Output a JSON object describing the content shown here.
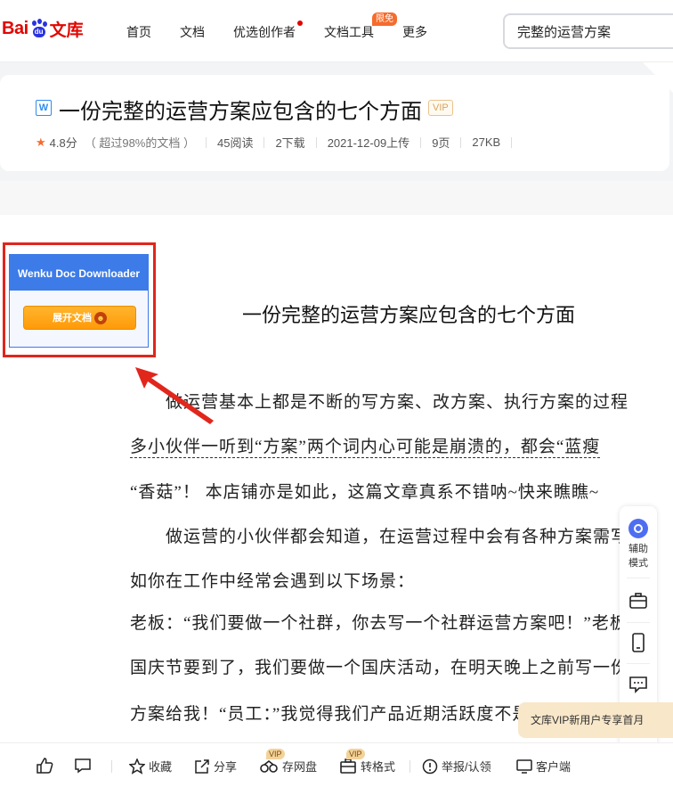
{
  "header": {
    "logo": {
      "bai": "Bai",
      "du": "du",
      "wenku": "文库"
    },
    "nav": [
      {
        "label": "首页"
      },
      {
        "label": "文档"
      },
      {
        "label": "优选创作者"
      },
      {
        "label": "文档工具",
        "tag": "限免"
      },
      {
        "label": "更多"
      }
    ],
    "search_value": "完整的运营方案"
  },
  "doc_info": {
    "type_icon": "W",
    "title": "一份完整的运营方案应包含的七个方面",
    "vip_badge": "VIP",
    "rating": "4.8分",
    "rating_note": "（ 超过98%的文档 ）",
    "reads": "45阅读",
    "downloads": "2下载",
    "upload_date": "2021-12-09上传",
    "pages": "9页",
    "size": "27KB"
  },
  "downloader": {
    "title": "Wenku Doc Downloader",
    "button_label": "展开文档"
  },
  "document": {
    "heading": "一份完整的运营方案应包含的七个方面",
    "lines": [
      "　　做运营基本上都是不断的写方案、改方案、执行方案的过程",
      "多小伙伴一听到“方案”两个词内心可能是崩溃的，都会“蓝瘦",
      "“香菇”！ 本店铺亦是如此，这篇文章真系不错呐~快来瞧瞧~",
      "　　做运营的小伙伴都会知道，在运营过程中会有各种方案需写",
      "如你在工作中经常会遇到以下场景：",
      "老板：“我们要做一个社群，你去写一个社群运营方案吧！”老板",
      "国庆节要到了，我们要做一个国庆活动，在明天晚上之前写一份",
      "方案给我！“员工：”我觉得我们产品近期活跃度不是很高"
    ]
  },
  "side_tools": {
    "assist_label_1": "辅助",
    "assist_label_2": "模式"
  },
  "vip_promo": "文库VIP新用户专享首月",
  "bottom_bar": {
    "collect": "收藏",
    "share": "分享",
    "save_disk": "存网盘",
    "convert": "转格式",
    "report": "举报/认领",
    "client": "客户端",
    "vip_tag": "VIP"
  },
  "colors": {
    "brand_red": "#e10601",
    "brand_blue": "#2932e1",
    "downloader_blue": "#3c7be8",
    "annotation_red": "#e1261c"
  }
}
